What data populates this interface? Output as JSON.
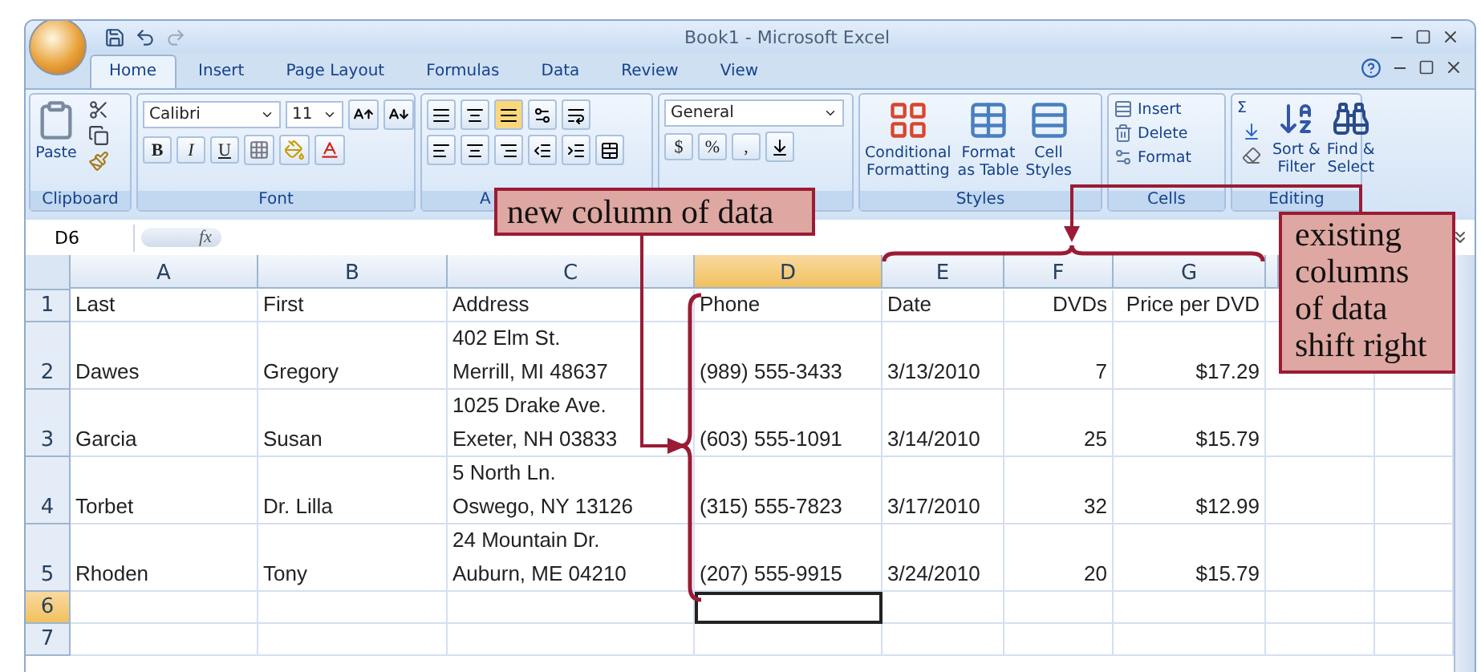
{
  "window": {
    "title": "Book1 - Microsoft Excel"
  },
  "tabs": [
    {
      "label": "Home",
      "selected": true
    },
    {
      "label": "Insert",
      "selected": false
    },
    {
      "label": "Page Layout",
      "selected": false
    },
    {
      "label": "Formulas",
      "selected": false
    },
    {
      "label": "Data",
      "selected": false
    },
    {
      "label": "Review",
      "selected": false
    },
    {
      "label": "View",
      "selected": false
    }
  ],
  "ribbon": {
    "groups": [
      {
        "kind": "clipboard",
        "label": "Clipboard",
        "paste": "Paste"
      },
      {
        "kind": "font",
        "label": "Font",
        "font_name": "Calibri",
        "font_size": "11",
        "buttons": [
          "B",
          "I",
          "U"
        ]
      },
      {
        "kind": "alignment",
        "label": "A"
      },
      {
        "kind": "number",
        "format": "General",
        "buttons": [
          "$",
          "%",
          ","
        ]
      },
      {
        "kind": "styles",
        "label": "Styles",
        "items": [
          "Conditional\nFormatting",
          "Format\nas Table",
          "Cell\nStyles"
        ]
      },
      {
        "kind": "cells",
        "label": "Cells",
        "items": [
          "Insert",
          "Delete",
          "Format"
        ]
      },
      {
        "kind": "editing",
        "label": "Editing",
        "sum": "Σ",
        "items": [
          "Sort &\nFilter",
          "Find &\nSelect"
        ]
      }
    ]
  },
  "formula_bar": {
    "name_box": "D6",
    "fx_label": "fx"
  },
  "sheet": {
    "columns": [
      {
        "letter": "A",
        "selected": false,
        "kind": "text"
      },
      {
        "letter": "B",
        "selected": false,
        "kind": "text"
      },
      {
        "letter": "C",
        "selected": false,
        "kind": "text"
      },
      {
        "letter": "D",
        "selected": true,
        "kind": "text"
      },
      {
        "letter": "E",
        "selected": false,
        "kind": "text"
      },
      {
        "letter": "F",
        "selected": false,
        "kind": "number"
      },
      {
        "letter": "G",
        "selected": false,
        "kind": "number"
      }
    ],
    "rows": [
      {
        "header": "1",
        "selected": false,
        "tall": false,
        "cells": [
          "Last",
          "First",
          "Address",
          "Phone",
          "Date",
          "DVDs",
          "Price per DVD"
        ]
      },
      {
        "header": "2",
        "selected": false,
        "tall": true,
        "cells": [
          "Dawes",
          "Gregory",
          "402 Elm St.\nMerrill, MI 48637",
          "(989) 555-3433",
          "3/13/2010",
          "7",
          "$17.29"
        ]
      },
      {
        "header": "3",
        "selected": false,
        "tall": true,
        "cells": [
          "Garcia",
          "Susan",
          "1025 Drake Ave.\nExeter, NH 03833",
          "(603) 555-1091",
          "3/14/2010",
          "25",
          "$15.79"
        ]
      },
      {
        "header": "4",
        "selected": false,
        "tall": true,
        "cells": [
          "Torbet",
          "Dr. Lilla",
          "5 North Ln.\nOswego, NY 13126",
          "(315) 555-7823",
          "3/17/2010",
          "32",
          "$12.99"
        ]
      },
      {
        "header": "5",
        "selected": false,
        "tall": true,
        "cells": [
          "Rhoden",
          "Tony",
          "24 Mountain Dr.\nAuburn, ME 04210",
          "(207) 555-9915",
          "3/24/2010",
          "20",
          "$15.79"
        ]
      },
      {
        "header": "6",
        "selected": true,
        "tall": false
      },
      {
        "header": "7",
        "selected": false,
        "tall": false
      }
    ]
  },
  "callouts": [
    {
      "kind": "new",
      "text": "new column of data"
    },
    {
      "kind": "shift",
      "text": "existing columns of data shift right"
    }
  ]
}
